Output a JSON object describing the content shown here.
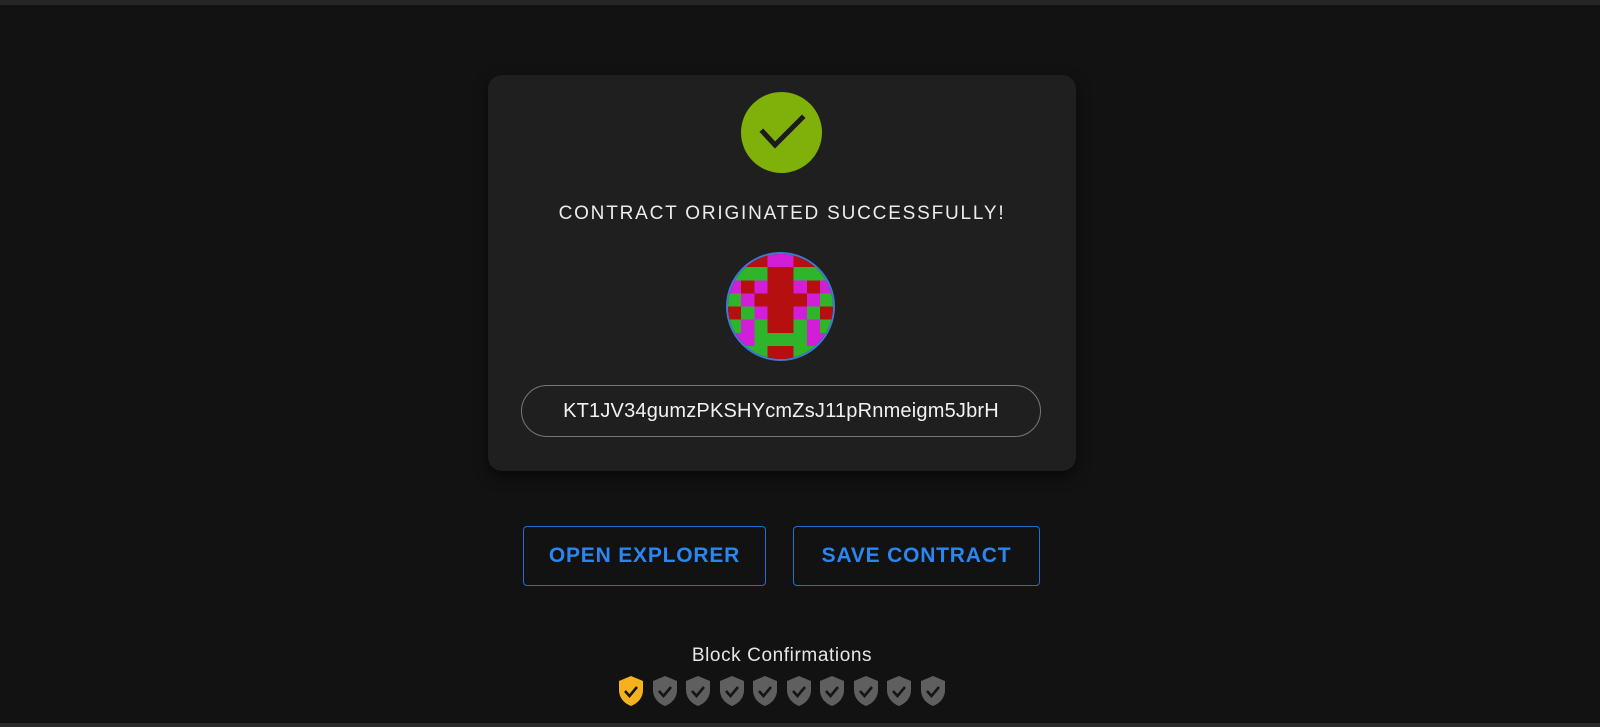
{
  "status": {
    "icon": "check-circle-icon",
    "icon_color": "#7fb10a",
    "title": "CONTRACT ORIGINATED SUCCESSFULLY!"
  },
  "contract": {
    "identicon": "contract-identicon",
    "identicon_colors": [
      "#2fb52b",
      "#b50f0f",
      "#d21ed7"
    ],
    "address": "KT1JV34gumzPKSHYcmZsJ11pRnmeigm5JbrH"
  },
  "actions": {
    "open_explorer_label": "OPEN EXPLORER",
    "save_contract_label": "SAVE CONTRACT",
    "accent_color": "#2a86f0"
  },
  "confirmations": {
    "label": "Block Confirmations",
    "confirmed": 1,
    "total": 10,
    "confirmed_color": "#f5b21c",
    "pending_color": "#5f5f5f",
    "icon": "shield-check-icon"
  }
}
